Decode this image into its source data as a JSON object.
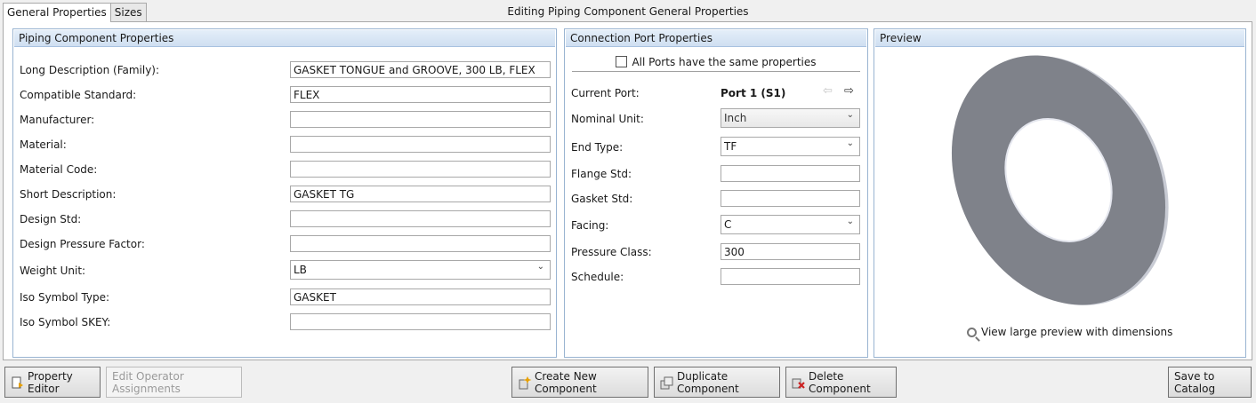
{
  "tabs": [
    {
      "label": "General Properties",
      "active": true
    },
    {
      "label": "Sizes",
      "active": false
    }
  ],
  "window_title": "Editing Piping Component General Properties",
  "piping_panel": {
    "title": "Piping Component Properties",
    "fields": {
      "long_description": {
        "label": "Long Description (Family):",
        "value": "GASKET TONGUE and GROOVE, 300 LB, FLEX"
      },
      "compatible_standard": {
        "label": "Compatible Standard:",
        "value": "FLEX"
      },
      "manufacturer": {
        "label": "Manufacturer:",
        "value": ""
      },
      "material": {
        "label": "Material:",
        "value": ""
      },
      "material_code": {
        "label": "Material Code:",
        "value": ""
      },
      "short_description": {
        "label": "Short Description:",
        "value": "GASKET TG"
      },
      "design_std": {
        "label": "Design Std:",
        "value": ""
      },
      "design_pressure_factor": {
        "label": "Design Pressure Factor:",
        "value": ""
      },
      "weight_unit": {
        "label": "Weight Unit:",
        "value": "LB"
      },
      "iso_symbol_type": {
        "label": "Iso Symbol Type:",
        "value": "GASKET"
      },
      "iso_symbol_skey": {
        "label": "Iso Symbol SKEY:",
        "value": ""
      }
    }
  },
  "connection_panel": {
    "title": "Connection Port Properties",
    "same_props_label": "All Ports have the same properties",
    "same_props_checked": false,
    "current_port_label": "Current Port:",
    "current_port_value": "Port 1 (S1)",
    "fields": {
      "nominal_unit": {
        "label": "Nominal Unit:",
        "value": "Inch"
      },
      "end_type": {
        "label": "End Type:",
        "value": "TF"
      },
      "flange_std": {
        "label": "Flange Std:",
        "value": ""
      },
      "gasket_std": {
        "label": "Gasket Std:",
        "value": ""
      },
      "facing": {
        "label": "Facing:",
        "value": "C"
      },
      "pressure_class": {
        "label": "Pressure Class:",
        "value": "300"
      },
      "schedule": {
        "label": "Schedule:",
        "value": ""
      }
    }
  },
  "preview_panel": {
    "title": "Preview",
    "link_label": "View large preview with dimensions",
    "gasket_color": "#7f828a"
  },
  "buttons": {
    "property_editor": "Property Editor",
    "edit_operator": "Edit Operator Assignments",
    "create_new": "Create New Component",
    "duplicate": "Duplicate Component",
    "delete": "Delete Component",
    "save_catalog": "Save to Catalog"
  },
  "colors": {
    "panel_border": "#99b4d1",
    "header_gradient_top": "#e4eef9",
    "header_gradient_bottom": "#cfdff1",
    "delete_icon": "#cc2222",
    "add_icon": "#e8a000"
  }
}
